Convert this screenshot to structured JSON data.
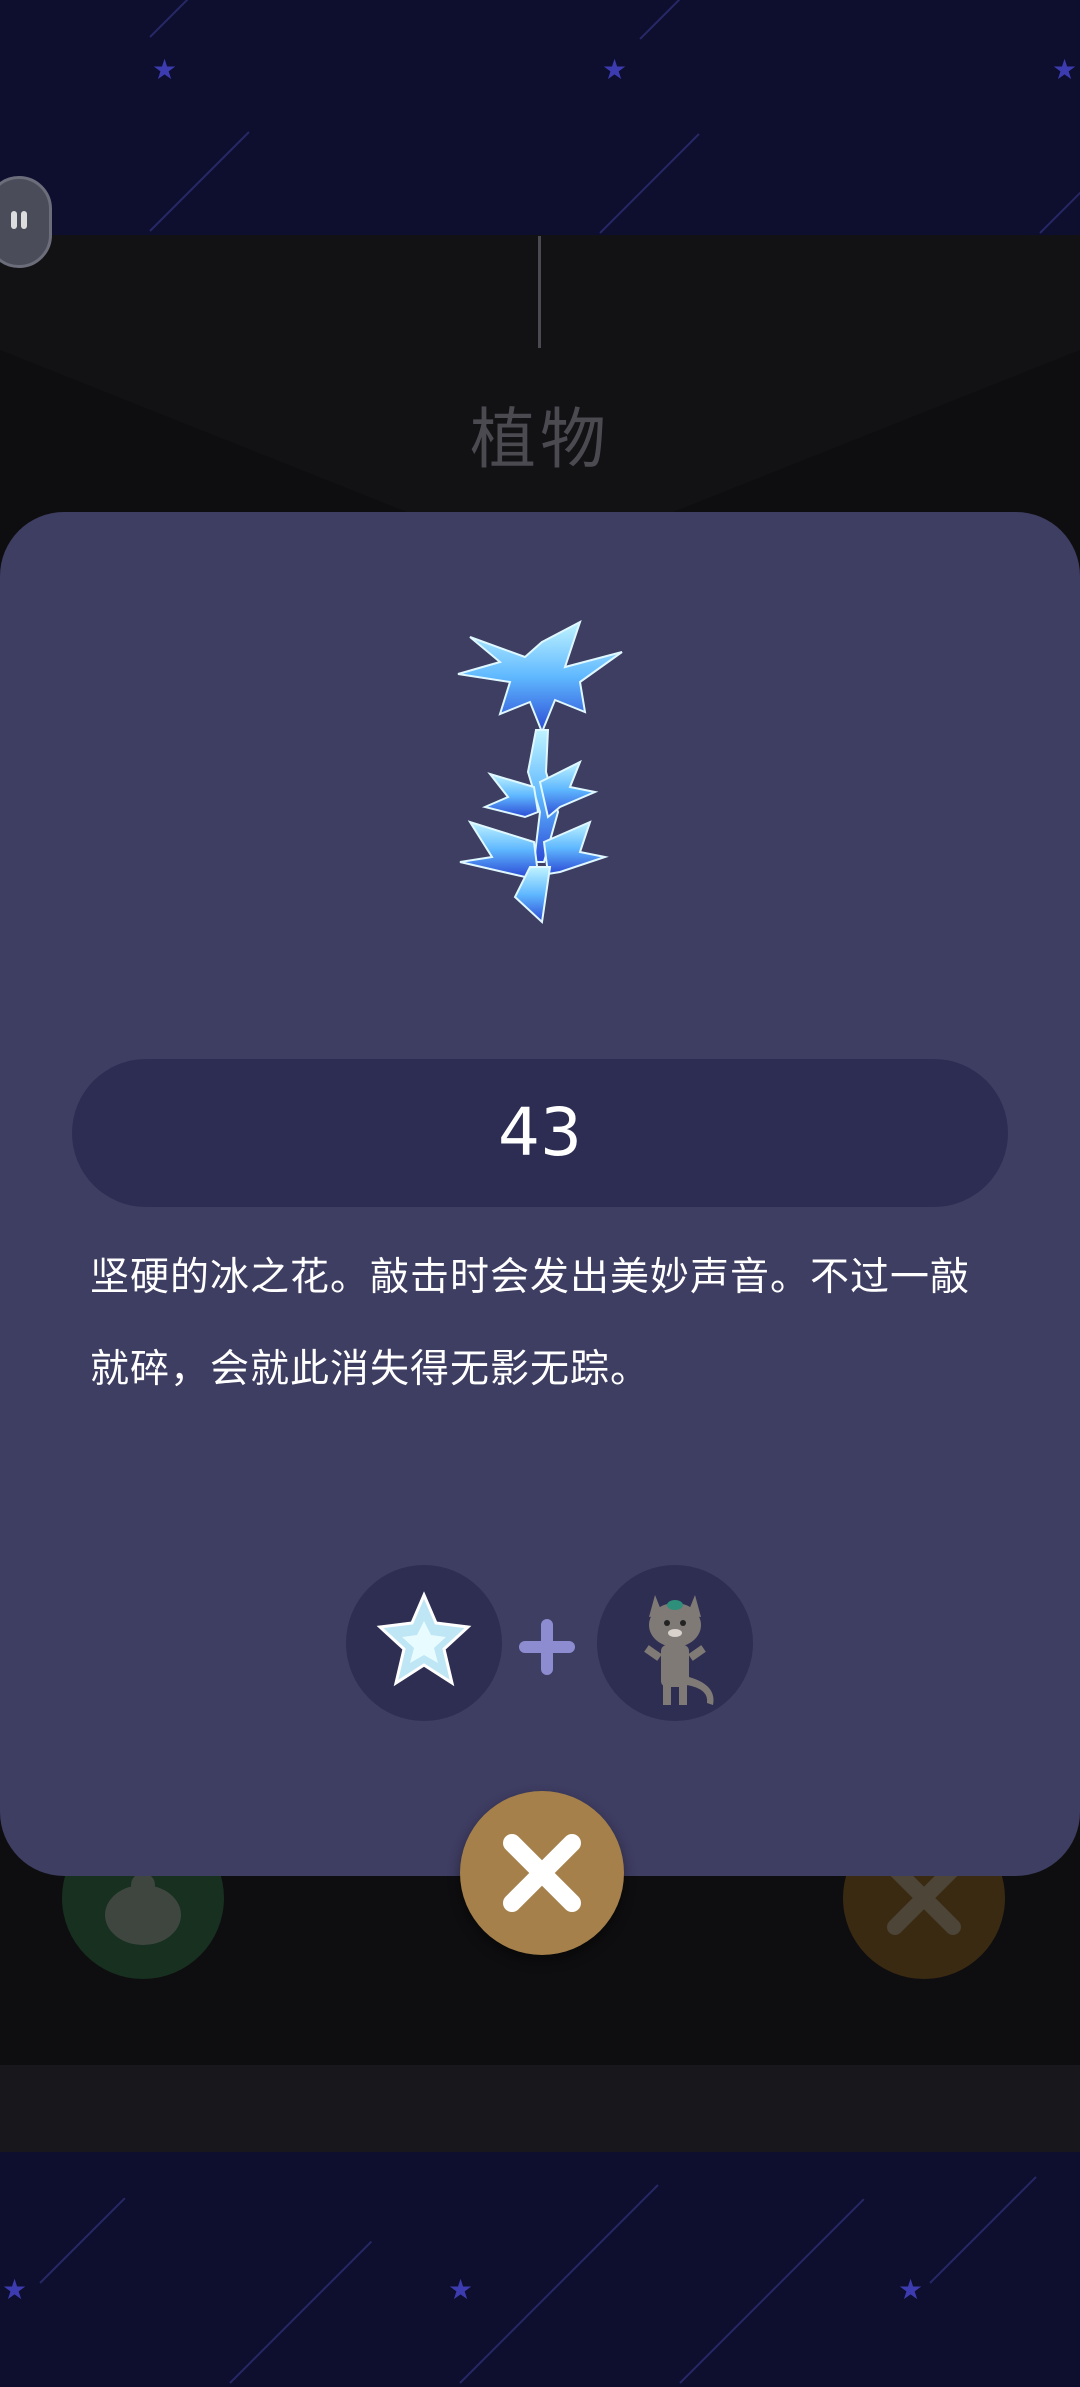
{
  "header": {
    "category_title": "植物"
  },
  "item": {
    "icon": "ice-flower-icon",
    "count": "43",
    "description": "坚硬的冰之花。敲击时会发出美妙声音。不过一敲就碎，会就此消失得无影无踪。"
  },
  "recipe": {
    "ingredient_1": "snowflake-flower-icon",
    "operator": "plus-icon",
    "ingredient_2": "cat-character-icon"
  },
  "controls": {
    "close": "close-icon",
    "pause": "pause-icon"
  },
  "colors": {
    "dialog_bg": "#3e3d62",
    "pill_bg": "#2d2d54",
    "close_button": "#a5804a",
    "accent_plus": "#8e8cd0"
  }
}
